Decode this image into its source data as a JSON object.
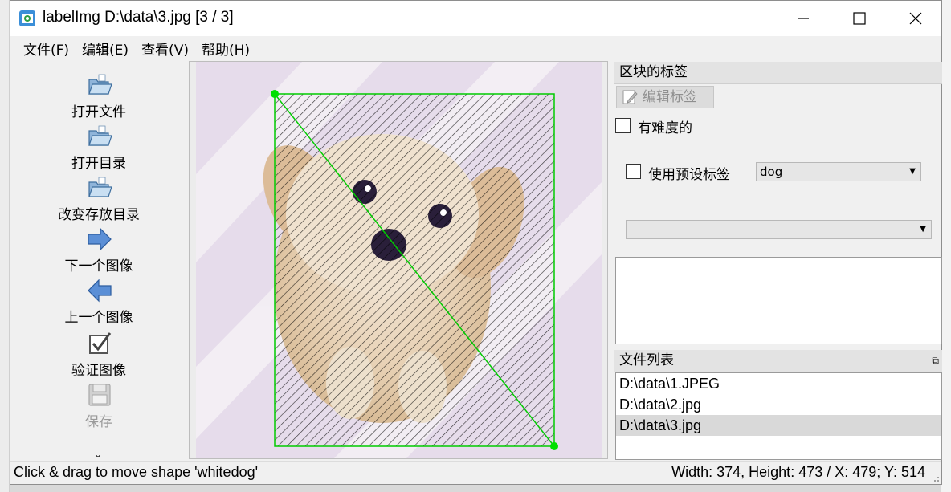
{
  "window": {
    "title": "labelImg D:\\data\\3.jpg [3 / 3]",
    "icon": "labelimg-app-icon",
    "controls": {
      "minimize": "minimize-icon",
      "maximize": "maximize-icon",
      "close": "close-icon"
    }
  },
  "menu": {
    "items": [
      {
        "label": "文件(F)"
      },
      {
        "label": "编辑(E)"
      },
      {
        "label": "查看(V)"
      },
      {
        "label": "帮助(H)"
      }
    ]
  },
  "toolbar": {
    "items": [
      {
        "label": "打开文件",
        "icon": "open-folder-icon",
        "enabled": true
      },
      {
        "label": "打开目录",
        "icon": "open-folder-icon",
        "enabled": true
      },
      {
        "label": "改变存放目录",
        "icon": "open-folder-icon",
        "enabled": true
      },
      {
        "label": "下一个图像",
        "icon": "arrow-right-icon",
        "enabled": true
      },
      {
        "label": "上一个图像",
        "icon": "arrow-left-icon",
        "enabled": true
      },
      {
        "label": "验证图像",
        "icon": "checkbox-icon",
        "enabled": true
      },
      {
        "label": "保存",
        "icon": "floppy-disk-icon",
        "enabled": false
      }
    ],
    "more_icon": "chevron-double-down-icon"
  },
  "canvas": {
    "image": "white-dog-photo",
    "shape_color": "#00cc00",
    "hatch_color": "#000000"
  },
  "box_labels_panel": {
    "title": "区块的标签",
    "edit_label_button": "编辑标签",
    "difficult_checkbox": {
      "label": "有难度的",
      "checked": false
    },
    "use_default_label": {
      "label": "使用预设标签",
      "checked": false,
      "value": "dog"
    },
    "label_combo_value": ""
  },
  "file_list_panel": {
    "title": "文件列表",
    "files": [
      {
        "name": "D:\\data\\1.JPEG",
        "selected": false
      },
      {
        "name": "D:\\data\\2.jpg",
        "selected": false
      },
      {
        "name": "D:\\data\\3.jpg",
        "selected": true
      }
    ]
  },
  "status": {
    "message": "Click & drag to move shape 'whitedog'",
    "coords": "Width: 374, Height: 473 / X: 479; Y: 514"
  }
}
